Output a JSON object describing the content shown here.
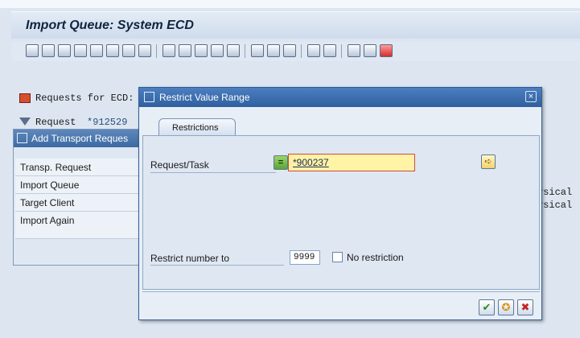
{
  "window": {
    "title": "Import Queue: System ECD"
  },
  "background": {
    "requests_label": "Requests for ECD:",
    "request_filter_label": "Request",
    "request_filter_value": "*912529",
    "right_column_values": [
      "ysical",
      "ysical"
    ]
  },
  "add_panel": {
    "title": "Add Transport Reques",
    "rows": [
      "Transp. Request",
      "Import Queue",
      "Target Client",
      "Import Again"
    ]
  },
  "dialog": {
    "title": "Restrict Value Range",
    "tab_label": "Restrictions",
    "request_task_label": "Request/Task",
    "request_task_value": "*900237",
    "restrict_number_label": "Restrict number to",
    "restrict_number_value": "9999",
    "no_restriction_label": "No restriction",
    "equal_sign_label": "=",
    "close_glyph": "×"
  },
  "icons": {
    "toolbar": [
      "refresh-icon",
      "print-icon",
      "filter-icon",
      "find-icon",
      "zoom-icon",
      "document-icon",
      "filter-edit-icon",
      "wrench-icon",
      "display-icon",
      "list-icon",
      "transport-icon",
      "copy-icon",
      "settings-icon",
      "lock-icon",
      "truck-icon",
      "truck-open-icon",
      "monitor-icon",
      "layout-icon",
      "tree-icon",
      "grid-icon",
      "help-icon"
    ]
  },
  "colors": {
    "dialog_header": "#2e5f9f",
    "input_bg": "#fff3a6",
    "input_border": "#d14b3b"
  }
}
